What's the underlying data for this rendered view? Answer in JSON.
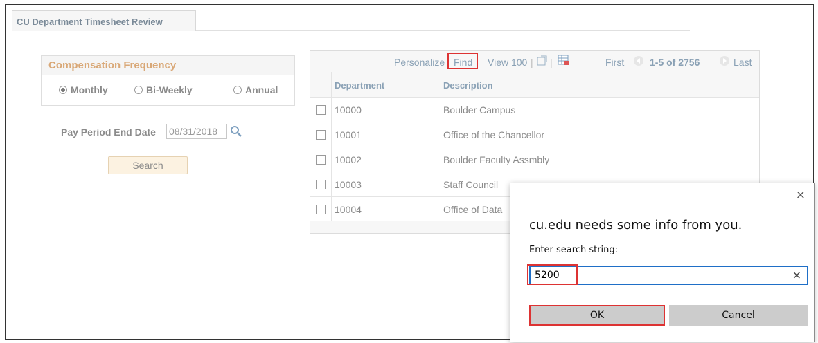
{
  "tab": {
    "title": "CU Department Timesheet Review"
  },
  "compensation": {
    "heading": "Compensation Frequency",
    "options": [
      {
        "label": "Monthly",
        "selected": true
      },
      {
        "label": "Bi-Weekly",
        "selected": false
      },
      {
        "label": "Annual",
        "selected": false
      }
    ]
  },
  "pay_period": {
    "label": "Pay Period End Date",
    "value": "08/31/2018"
  },
  "search_button": {
    "label": "Search"
  },
  "grid": {
    "personalize": "Personalize",
    "find": "Find",
    "view": "View 100",
    "first": "First",
    "range": "1-5 of 2756",
    "last": "Last",
    "columns": {
      "department": "Department",
      "description": "Description"
    },
    "rows": [
      {
        "department": "10000",
        "description": "Boulder Campus"
      },
      {
        "department": "10001",
        "description": "Office of the Chancellor"
      },
      {
        "department": "10002",
        "description": "Boulder Faculty Assmbly"
      },
      {
        "department": "10003",
        "description": "Staff Council"
      },
      {
        "department": "10004",
        "description": "Office of Data"
      }
    ]
  },
  "dialog": {
    "close": "×",
    "title": "cu.edu needs some info from you.",
    "prompt": "Enter search string:",
    "input_value": "5200",
    "clear": "×",
    "ok": "OK",
    "cancel": "Cancel"
  },
  "colors": {
    "highlight_red": "#dd3333",
    "focus_blue": "#1f6fc7",
    "heading_orange": "#d9a877"
  }
}
